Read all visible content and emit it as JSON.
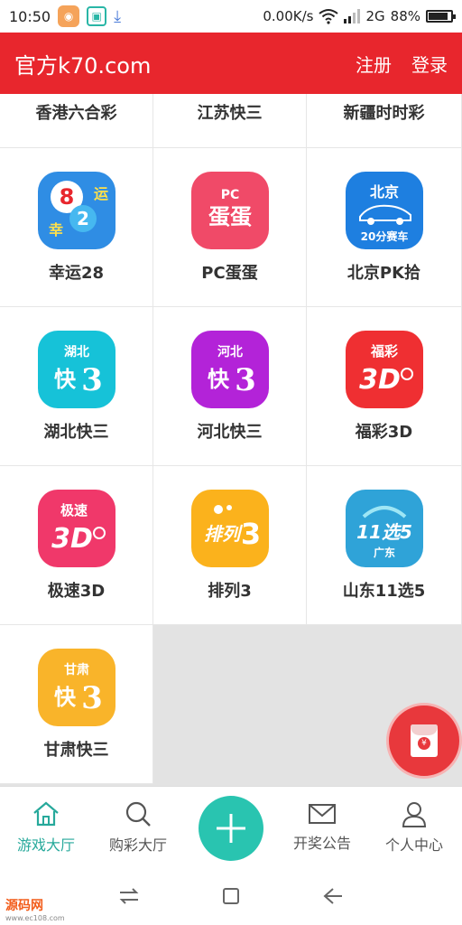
{
  "status_bar": {
    "time": "10:50",
    "network_speed": "0.00K/s",
    "network_type": "2G",
    "battery": "88%",
    "battery_level": 0.88
  },
  "header": {
    "title": "官方k70.com",
    "register": "注册",
    "login": "登录"
  },
  "partial_row": [
    "香港六合彩",
    "江苏快三",
    "新疆时时彩"
  ],
  "games": [
    {
      "label": "幸运28",
      "icon": "lucky28-icon",
      "color": "#2f8de4",
      "glyph": "8 运\n幸 2"
    },
    {
      "label": "PC蛋蛋",
      "icon": "pc-egg-icon",
      "color": "#f04a68",
      "glyph": "PC\n蛋蛋"
    },
    {
      "label": "北京PK拾",
      "icon": "beijing-pk10-icon",
      "color": "#1e7fe0",
      "glyph": "北京\n20分赛车"
    },
    {
      "label": "湖北快三",
      "icon": "hubei-k3-icon",
      "color": "#16c2d8",
      "glyph": "湖北\n快3"
    },
    {
      "label": "河北快三",
      "icon": "hebei-k3-icon",
      "color": "#b323d8",
      "glyph": "河北\n快3"
    },
    {
      "label": "福彩3D",
      "icon": "fucai-3d-icon",
      "color": "#ef2f32",
      "glyph": "福彩\n3D"
    },
    {
      "label": "极速3D",
      "icon": "jisu-3d-icon",
      "color": "#f0386a",
      "glyph": "极速\n3D"
    },
    {
      "label": "排列3",
      "icon": "pailie3-icon",
      "color": "#fbb21c",
      "glyph": "排列3"
    },
    {
      "label": "山东11选5",
      "icon": "shandong-11x5-icon",
      "color": "#2fa3d8",
      "glyph": "11选5\n广东"
    },
    {
      "label": "甘肃快三",
      "icon": "gansu-k3-icon",
      "color": "#f9b42a",
      "glyph": "甘肃\n快3"
    }
  ],
  "bottom_nav": {
    "lobby": "游戏大厅",
    "buy": "购彩大厅",
    "results": "开奖公告",
    "profile": "个人中心"
  },
  "watermark": {
    "name": "源码网",
    "url": "www.ec108.com"
  },
  "colors": {
    "header": "#e8262d",
    "accent": "#27a99b",
    "fab": "#29c4b0"
  }
}
